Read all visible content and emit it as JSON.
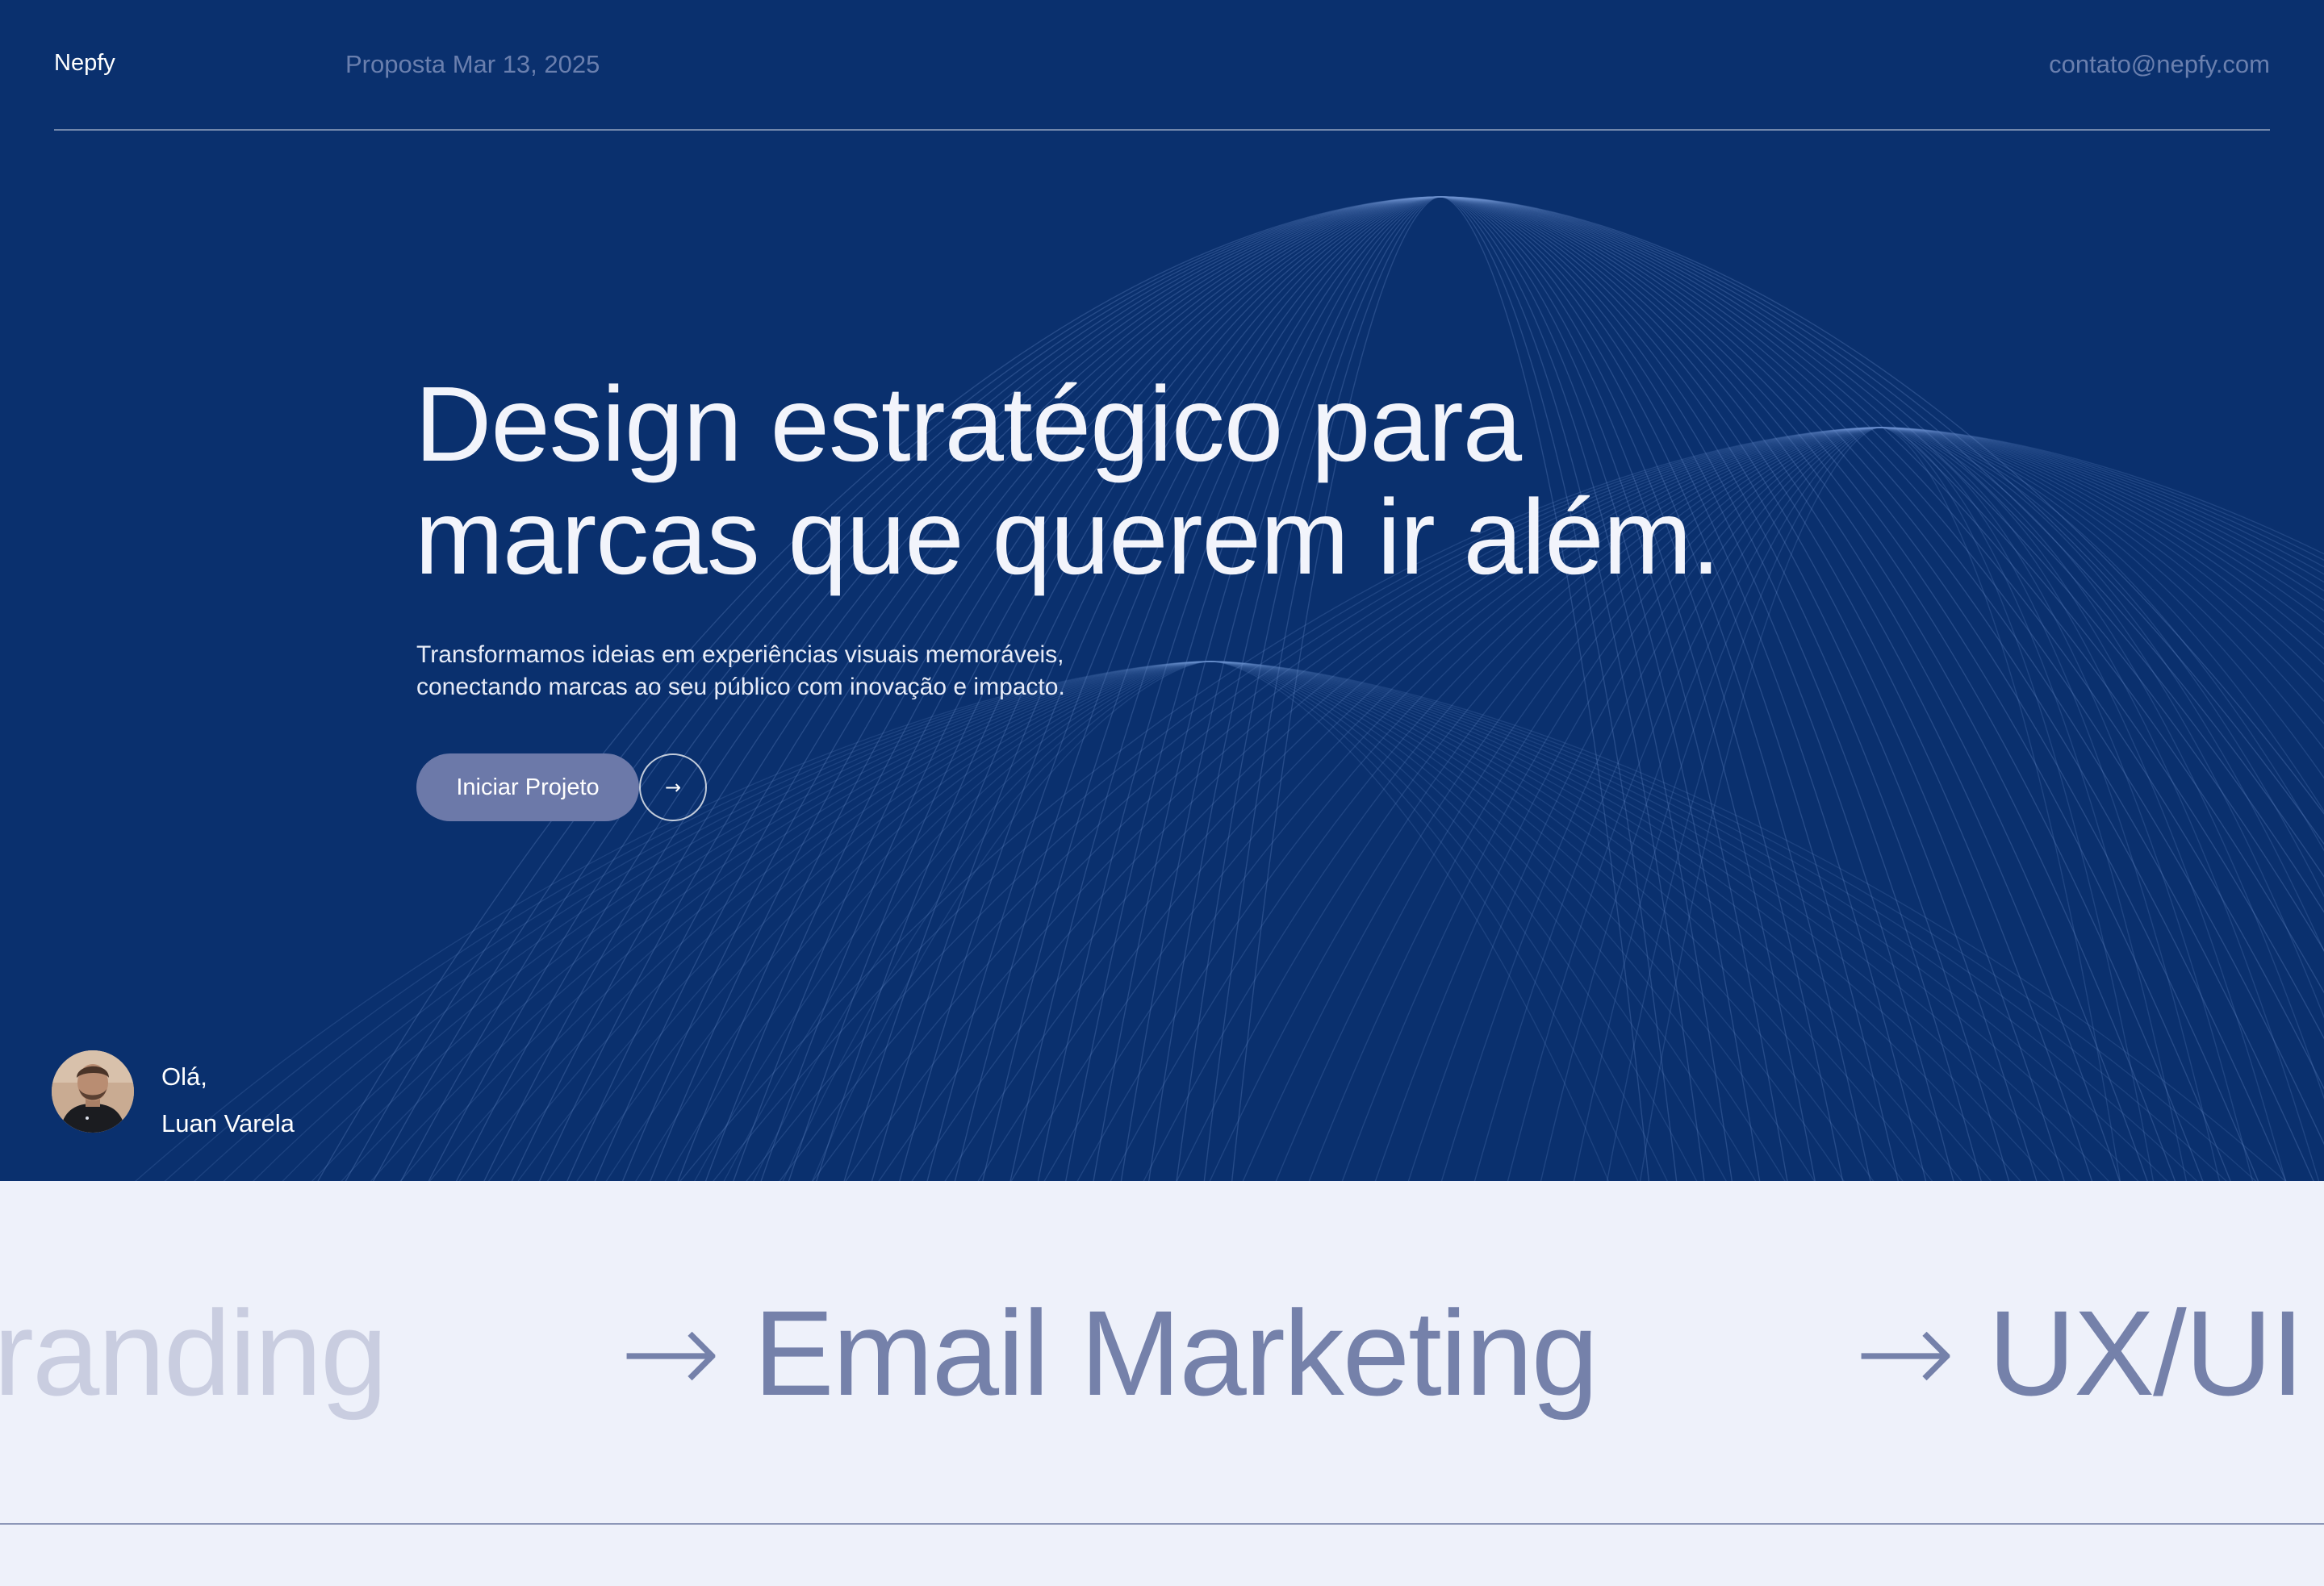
{
  "header": {
    "brand": "Nepfy",
    "proposal_date": "Proposta Mar 13, 2025",
    "email": "contato@nepfy.com"
  },
  "hero": {
    "headline_line1": "Design estratégico para",
    "headline_line2": "marcas que querem ir além.",
    "subtext_line1": "Transformamos ideias em experiências visuais memoráveis,",
    "subtext_line2": "conectando marcas ao seu público com inovação e impacto.",
    "cta_label": "Iniciar Projeto",
    "cta_arrow": "→"
  },
  "client": {
    "greeting": "Olá,",
    "name": "Luan Varela"
  },
  "services_marquee": {
    "items": [
      {
        "arrow": "",
        "label": "randing"
      },
      {
        "arrow": "→",
        "label": "Email Marketing"
      },
      {
        "arrow": "→",
        "label": "UX/UI"
      }
    ]
  },
  "colors": {
    "hero_bg": "#0a306e",
    "cta_bg": "#6c79a9",
    "marquee_bg": "#eef1fa",
    "marquee_text": "#7581aa"
  },
  "icons": {
    "cta_arrow": "arrow-right-icon",
    "marquee_arrow": "arrow-right-icon"
  }
}
